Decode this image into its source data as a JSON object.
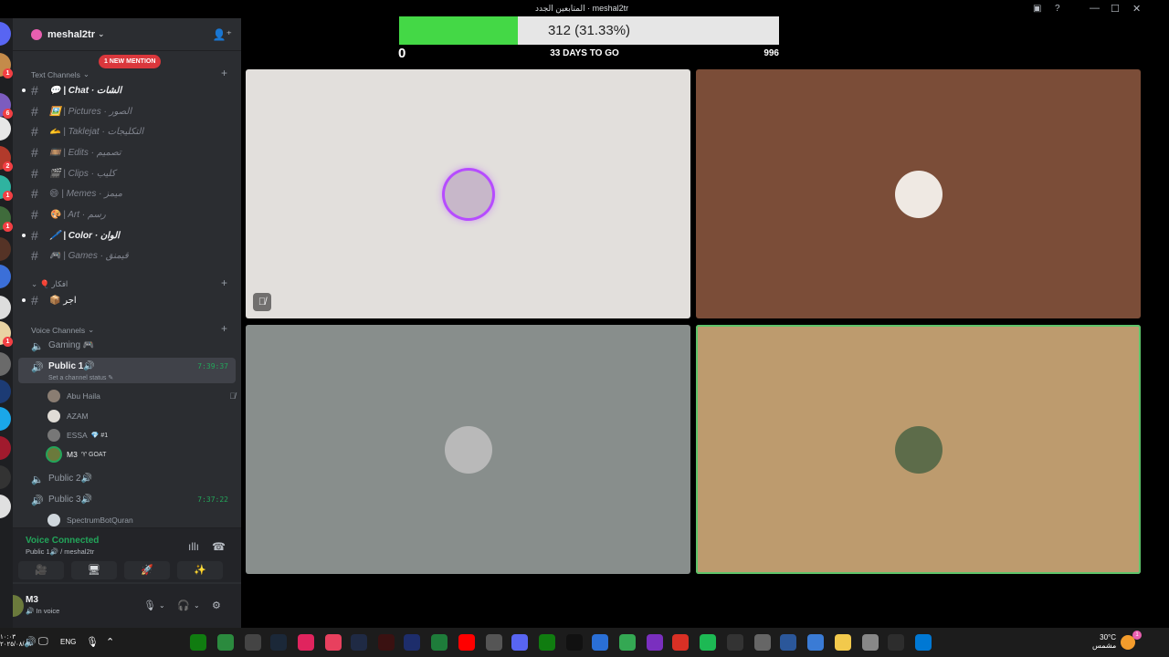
{
  "window": {
    "title": "meshal2tr",
    "title_overlay": "المتابعين الجدد"
  },
  "server": {
    "name": "meshal2tr",
    "mention_pill": "1 NEW MENTION"
  },
  "categories": {
    "text": "Text Channels",
    "archive": "⌄ 🎈 افكار",
    "voice": "Voice Channels"
  },
  "text_channels": [
    {
      "label": "💬 | Chat · الشات",
      "unread": true
    },
    {
      "label": "🖼️ | Pictures · الصور",
      "unread": false
    },
    {
      "label": "🫴 | Taklejat · التكليجات",
      "unread": false
    },
    {
      "label": "🎞️ | Edits · تصميم",
      "unread": false
    },
    {
      "label": "🎬 | Clips · كليب",
      "unread": false
    },
    {
      "label": "😄 | Memes · ميمز",
      "unread": false
    },
    {
      "label": "🎨 | Art · رسم",
      "unread": false
    },
    {
      "label": "🖊️ | Color · الوان",
      "unread": true
    },
    {
      "label": "🎮 | Games · قيمنق",
      "unread": false
    }
  ],
  "archive_channel": {
    "label": "📦 اجر"
  },
  "voice_channels": {
    "gaming": {
      "label": "Gaming 🎮"
    },
    "public1": {
      "label": "Public 1🔊",
      "timer": "7:39:37",
      "status": "Set a channel status ✎"
    },
    "public2": {
      "label": "Public 2🔊"
    },
    "public3": {
      "label": "Public 3🔊",
      "timer": "7:37:22"
    }
  },
  "voice_users": [
    {
      "name": "Abu Haila",
      "tag": "",
      "color": "#8a7d72"
    },
    {
      "name": "AZAM",
      "tag": "",
      "color": "#e0dcd6"
    },
    {
      "name": "ESSA",
      "tag": "💎 #1",
      "color": "#777"
    },
    {
      "name": "M3",
      "tag": "♈ GOAT",
      "color": "#6b7a3c"
    }
  ],
  "voice_users_p3": [
    {
      "name": "SpectrumBotQuran",
      "color": "#cfd6dc"
    }
  ],
  "voice_panel": {
    "title": "Voice Connected",
    "subtitle": "Public 1🔊 / meshal2tr",
    "buttons": [
      "🎥",
      "🖥",
      "🚀",
      "✨"
    ]
  },
  "user_panel": {
    "name": "M3",
    "status": "🔊 In voice"
  },
  "progress": {
    "value_text": "312 (31.33%)",
    "min": "0",
    "max": "996",
    "days_left": "33 DAYS TO GO",
    "fraction": 0.3133,
    "fill_color": "#44d846"
  },
  "tiles": [
    {
      "bg": "#e2dfdc",
      "avatar": "#c7b7c9",
      "ring": "#b64cff",
      "speaking": true,
      "muted_icon": "🎙"
    },
    {
      "bg": "#7b4d38",
      "avatar": "#efe9e3",
      "ring": "",
      "speaking": false
    },
    {
      "bg": "#888e8c",
      "avatar": "#b9b9b9",
      "ring": "",
      "speaking": false
    },
    {
      "bg": "#bd9b6e",
      "avatar": "#5d6c4a",
      "ring": "#5ec46a",
      "speaking": false
    }
  ],
  "taskbar": {
    "time": "١٠:٠٣",
    "date": "٢٠٢٥/٠٨/٠٨",
    "language": "ENG",
    "weather_temp": "30°C",
    "weather_desc": "مشمس",
    "weather_badge": "1"
  },
  "colors": {
    "accent_green": "#23a55a",
    "mention_red": "#da373c"
  }
}
